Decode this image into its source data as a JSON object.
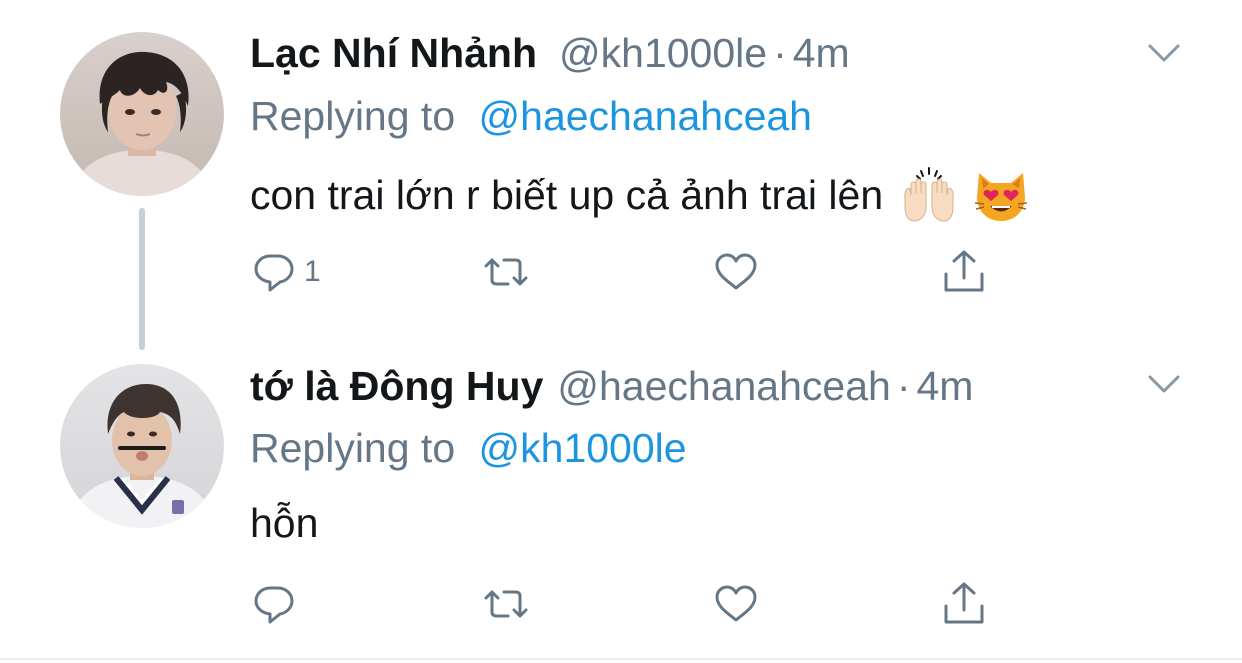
{
  "tweets": [
    {
      "display_name": "Lạc Nhí Nhảnh",
      "handle": "@kh1000le",
      "separator": "·",
      "time": "4m",
      "replying_prefix": "Replying to",
      "replying_to": "@haechanahceah",
      "text": "con trai lớn r biết up cả ảnh trai lên",
      "emojis": [
        "raising-hands-emoji",
        "heart-eyes-cat-emoji"
      ],
      "actions": {
        "reply_count": "1",
        "retweet_count": "",
        "like_count": ""
      }
    },
    {
      "display_name": "tớ là Đông Huy",
      "handle": "@haechanahceah",
      "separator": "·",
      "time": "4m",
      "replying_prefix": "Replying to",
      "replying_to": "@kh1000le",
      "text": "hỗn",
      "emojis": [],
      "actions": {
        "reply_count": "",
        "retweet_count": "",
        "like_count": ""
      }
    }
  ],
  "icons": {
    "reply": "reply-icon",
    "retweet": "retweet-icon",
    "like": "heart-icon",
    "share": "share-icon",
    "more": "chevron-down-icon"
  },
  "colors": {
    "text_primary": "#14171a",
    "text_secondary": "#657786",
    "link": "#1b95e0",
    "thread_line": "#c4cfd6",
    "icon": "#657786"
  }
}
